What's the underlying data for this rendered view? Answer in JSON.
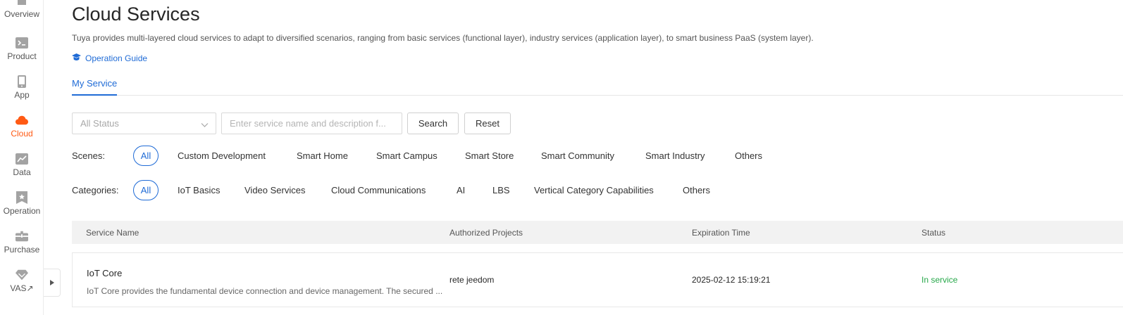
{
  "sidebar": {
    "items": [
      {
        "label": "Overview",
        "icon": "home-icon"
      },
      {
        "label": "Product",
        "icon": "terminal-icon"
      },
      {
        "label": "App",
        "icon": "phone-icon"
      },
      {
        "label": "Cloud",
        "icon": "cloud-icon"
      },
      {
        "label": "Data",
        "icon": "chart-icon"
      },
      {
        "label": "Operation",
        "icon": "bookmark-star-icon"
      },
      {
        "label": "Purchase",
        "icon": "box-icon"
      },
      {
        "label": "VAS↗",
        "icon": "diamond-icon"
      }
    ],
    "active_color": "#ff5a14"
  },
  "header": {
    "title": "Cloud Services",
    "description": "Tuya provides multi-layered cloud services to adapt to diversified scenarios, ranging from basic services (functional layer), industry services (application layer), to smart business PaaS (system layer).",
    "guide_label": "Operation Guide"
  },
  "tabs": [
    {
      "label": "My Service"
    }
  ],
  "filters": {
    "status_value": "All Status",
    "search_placeholder": "Enter service name and description f...",
    "search_label": "Search",
    "reset_label": "Reset",
    "scenes_label": "Scenes:",
    "scenes": [
      "All",
      "Custom Development",
      "Smart Home",
      "Smart Campus",
      "Smart Store",
      "Smart Community",
      "Smart Industry",
      "Others"
    ],
    "categories_label": "Categories:",
    "categories": [
      "All",
      "IoT Basics",
      "Video Services",
      "Cloud Communications",
      "AI",
      "LBS",
      "Vertical Category Capabilities",
      "Others"
    ]
  },
  "table": {
    "columns": [
      "Service Name",
      "Authorized Projects",
      "Expiration Time",
      "Status"
    ],
    "rows": [
      {
        "name": "IoT Core",
        "description": "IoT Core provides the fundamental device connection and device management. The secured ...",
        "project": "rete jeedom",
        "expiration": "2025-02-12 15:19:21",
        "status": "In service"
      }
    ]
  },
  "colors": {
    "accent": "#1f6bd6",
    "status_ok": "#27a84a",
    "brand": "#ff5a14"
  }
}
